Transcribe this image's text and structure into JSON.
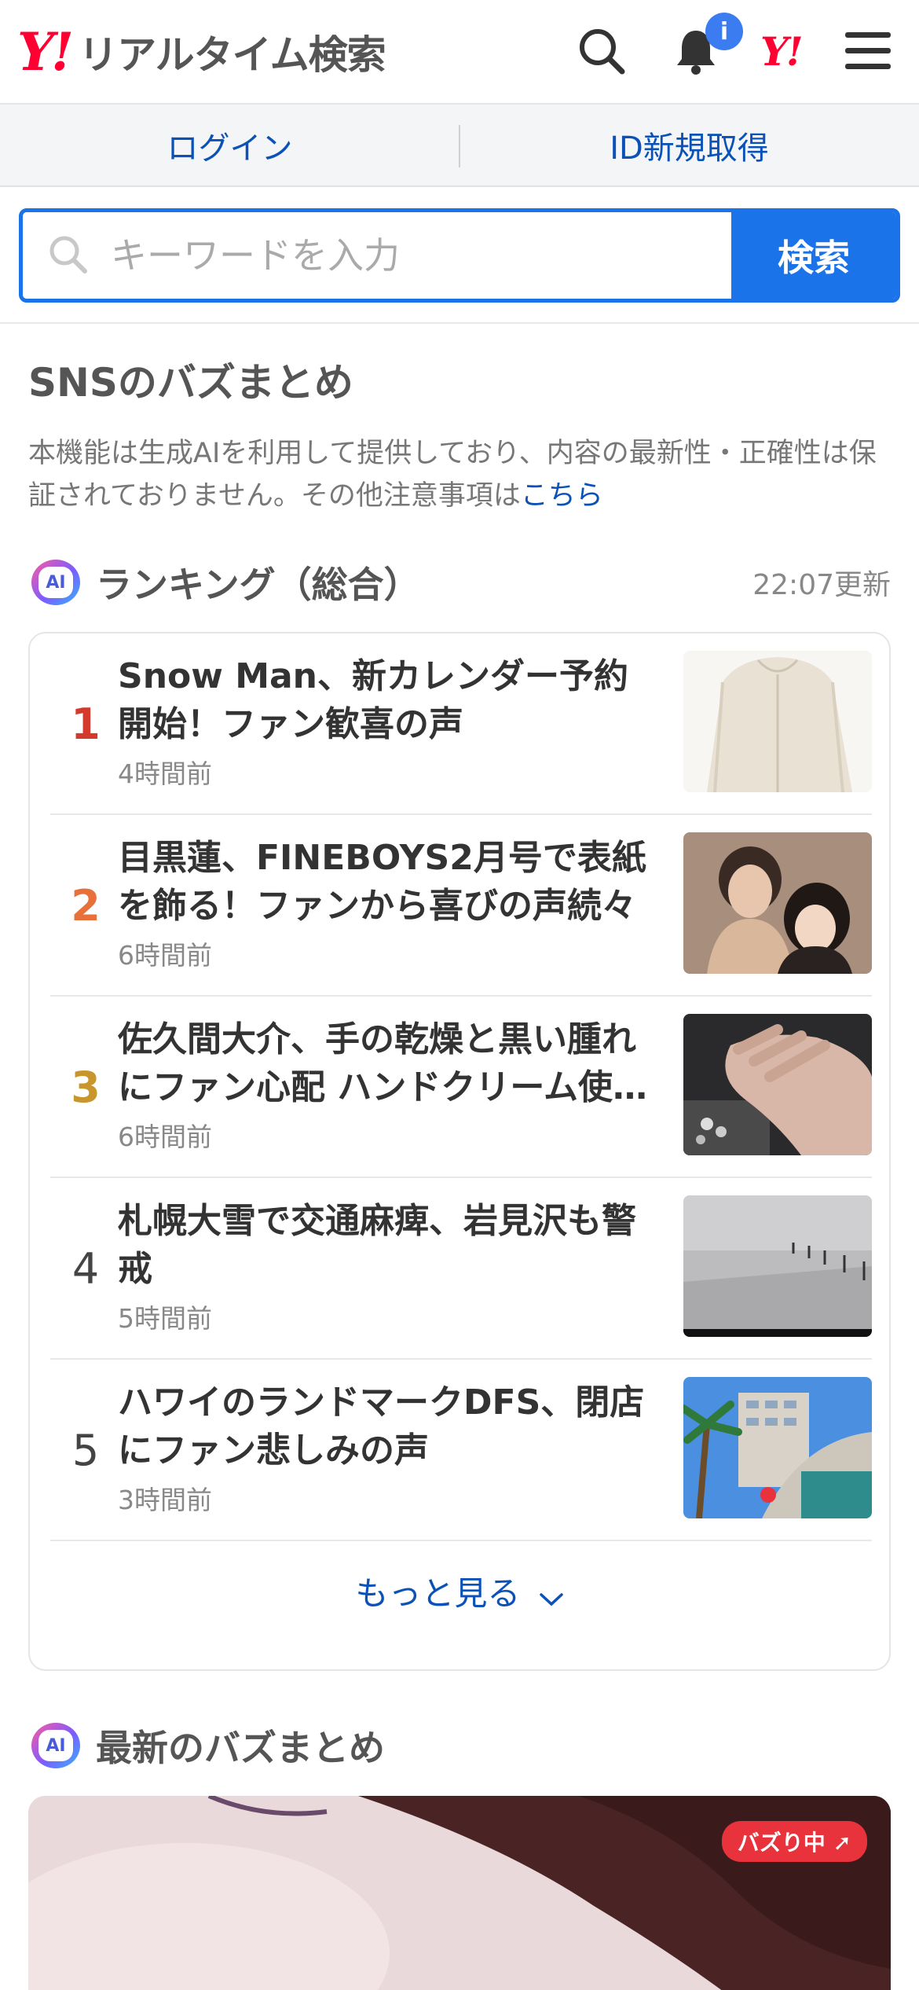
{
  "header": {
    "logo_mark": "Y!",
    "logo_text": "リアルタイム検索",
    "notification_badge": "i",
    "yahoo_mark": "Y!"
  },
  "auth": {
    "login": "ログイン",
    "register": "ID新規取得"
  },
  "search": {
    "placeholder": "キーワードを入力",
    "button": "検索"
  },
  "buzz": {
    "title": "SNSのバズまとめ",
    "notice": "本機能は生成AIを利用して提供しており、内容の最新性・正確性は保証されておりません。その他注意事項は",
    "notice_link": "こちら"
  },
  "ranking": {
    "ai_label": "AI",
    "title": "ランキング（総合）",
    "updated": "22:07更新",
    "items": [
      {
        "rank": "1",
        "title": "Snow Man、新カレンダー予約開始！ファン歓喜の声",
        "time": "4時間前",
        "rank_color": "#d33a2c"
      },
      {
        "rank": "2",
        "title": "目黒蓮、FINEBOYS2月号で表紙を飾る！ファンから喜びの声続々",
        "time": "6時間前",
        "rank_color": "#e8703a"
      },
      {
        "rank": "3",
        "title": "佐久間大介、手の乾燥と黒い腫れにファン心配 ハンドクリーム使…",
        "time": "6時間前",
        "rank_color": "#c9962e"
      },
      {
        "rank": "4",
        "title": "札幌大雪で交通麻痺、岩見沢も警戒",
        "time": "5時間前",
        "rank_color": "#444444"
      },
      {
        "rank": "5",
        "title": "ハワイのランドマークDFS、閉店にファン悲しみの声",
        "time": "3時間前",
        "rank_color": "#444444"
      }
    ],
    "more": "もっと見る"
  },
  "latest": {
    "ai_label": "AI",
    "title": "最新のバズまとめ",
    "badge": "バズり中"
  },
  "colors": {
    "accent": "#1a73e8",
    "link": "#0b52b8",
    "brand": "#ff0033"
  }
}
